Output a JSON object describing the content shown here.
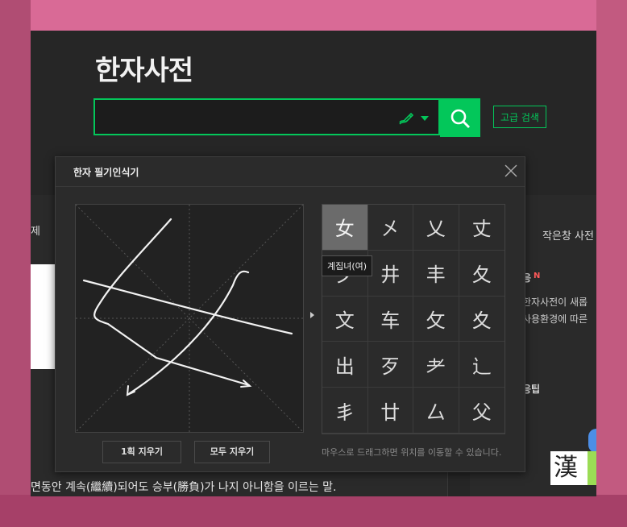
{
  "app": {
    "title": "한자사전"
  },
  "search": {
    "value": "",
    "advanced_label": "고급 검색"
  },
  "background": {
    "tab_label": "제",
    "right_texts": [
      "응",
      "N",
      "한자사전이 새롭",
      "사용환경에 따른",
      "응팁"
    ],
    "small_window_link": "작은창 사전",
    "definition_text": "면동안 계속(繼續)되어도 승부(勝負)가 나지 아니함을 이르는 말.",
    "hanja_logo": "漢"
  },
  "popup": {
    "title": "한자 필기인식기",
    "candidates": [
      "女",
      "㐅",
      "乂",
      "丈",
      "夕",
      "井",
      "丰",
      "夂",
      "文",
      "车",
      "攵",
      "夊",
      "出",
      "歹",
      "⺹",
      "辶",
      "丯",
      "廿",
      "厶",
      "父"
    ],
    "selected_index": 0,
    "tooltip": "계집녀(여)",
    "undo_label": "1획 지우기",
    "clear_label": "모두 지우기",
    "hint": "마우스로 드래그하면 위치를 이동할 수 있습니다."
  },
  "colors": {
    "accent": "#03c75a",
    "panel_bg": "#2b2b2b",
    "app_bg": "#262626"
  }
}
